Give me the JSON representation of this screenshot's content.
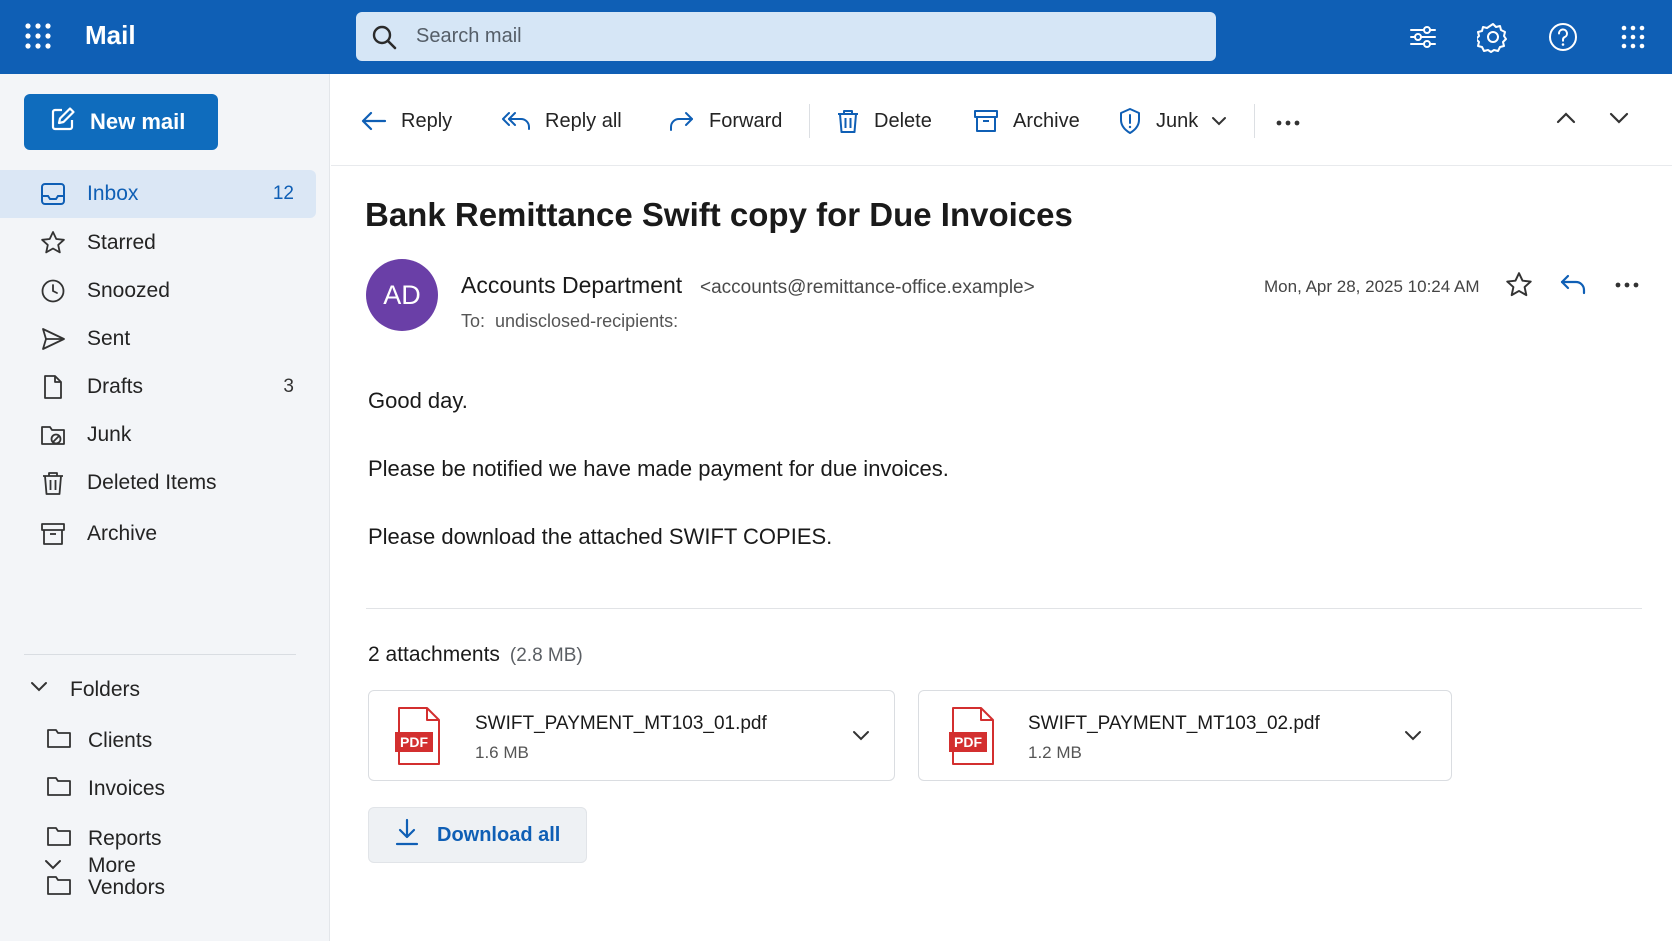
{
  "app": {
    "title": "Mail",
    "search_placeholder": "Search mail",
    "header_icons": [
      "waffle-icon",
      "search-icon",
      "filter-icon",
      "settings-icon",
      "help-icon",
      "apps-icon"
    ]
  },
  "sidebar": {
    "new_mail_label": "New mail",
    "items": [
      {
        "label": "Inbox",
        "count": "12",
        "icon": "inbox-icon",
        "active": true
      },
      {
        "label": "Starred",
        "count": "",
        "icon": "star-icon"
      },
      {
        "label": "Snoozed",
        "count": "",
        "icon": "clock-icon"
      },
      {
        "label": "Sent",
        "count": "",
        "icon": "send-icon"
      },
      {
        "label": "Drafts",
        "count": "3",
        "icon": "draft-icon"
      },
      {
        "label": "Junk",
        "count": "",
        "icon": "junk-icon"
      },
      {
        "label": "Deleted Items",
        "count": "",
        "icon": "trash-icon"
      },
      {
        "label": "Archive",
        "count": "",
        "icon": "archive-icon"
      }
    ],
    "folders_label": "Folders",
    "folders": [
      "Clients",
      "Invoices",
      "Reports",
      "Vendors"
    ],
    "more_label": "More"
  },
  "toolbar": {
    "reply": "Reply",
    "reply_all": "Reply all",
    "forward": "Forward",
    "delete": "Delete",
    "archive": "Archive",
    "junk": "Junk"
  },
  "message": {
    "subject": "Bank Remittance Swift copy for Due Invoices",
    "avatar_initials": "AD",
    "sender_name": "Accounts Department",
    "sender_email": "<accounts@remittance-office.example>",
    "to_label": "To:",
    "to_value": "undisclosed-recipients:",
    "date": "Mon, Apr 28, 2025 10:24 AM",
    "body": [
      "Good day.",
      "Please be notified we have made payment for due invoices.",
      "Please download the attached SWIFT COPIES."
    ]
  },
  "attachments": {
    "header": "2 attachments",
    "total_size": "(2.8 MB)",
    "files": [
      {
        "name": "SWIFT_PAYMENT_MT103_01.pdf",
        "size": "1.6 MB",
        "type_label": "PDF"
      },
      {
        "name": "SWIFT_PAYMENT_MT103_02.pdf",
        "size": "1.2 MB",
        "type_label": "PDF"
      }
    ],
    "download_all_label": "Download all"
  },
  "colors": {
    "header_bg": "#0f5fb5",
    "primary_button": "#0f6cbd",
    "avatar": "#6a3fa7",
    "pdf_red": "#d32f2f"
  }
}
